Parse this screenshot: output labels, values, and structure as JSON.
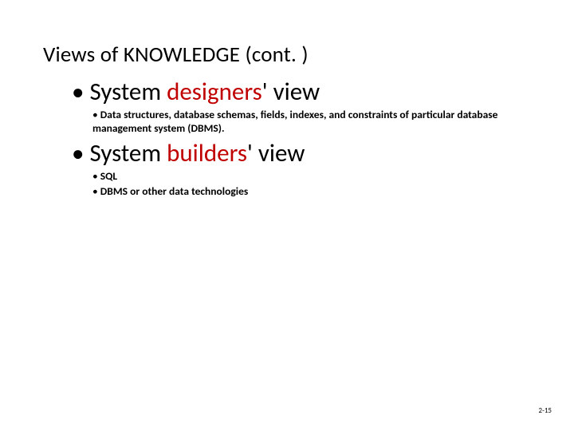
{
  "title": "Views of KNOWLEDGE (cont. )",
  "sections": {
    "designers": {
      "pre": "System ",
      "accent": "designers",
      "post": "' view",
      "bullets": {
        "0": "Data structures, database schemas, fields, indexes, and constraints of particular database management system (DBMS)."
      }
    },
    "builders": {
      "pre": "System ",
      "accent": "builders",
      "post": "' view",
      "bullets": {
        "0": "SQL",
        "1": "DBMS or other data technologies"
      }
    }
  },
  "page_number": "2-15"
}
